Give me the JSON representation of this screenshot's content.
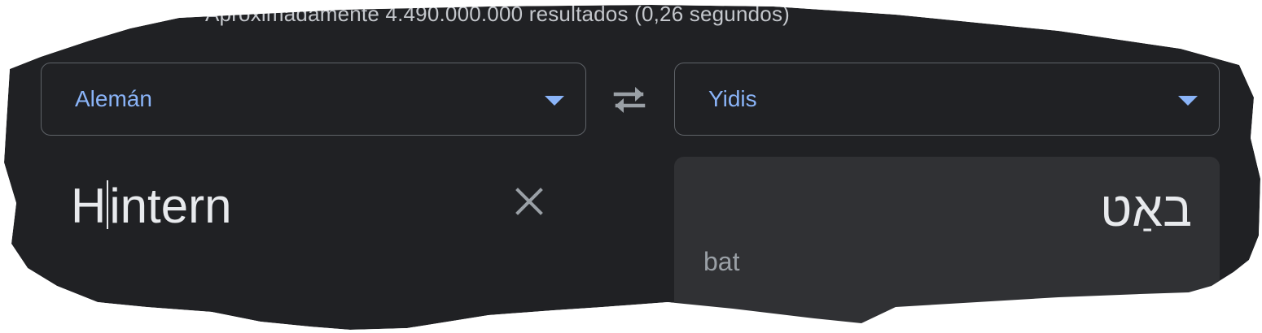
{
  "results": {
    "stats_text": "Aproximadamente 4.490.000.000 resultados (0,26 segundos)"
  },
  "translator": {
    "source_language": "Alemán",
    "target_language": "Yidis",
    "source_text_before_cursor": "H",
    "source_text_after_cursor": "intern",
    "translation": "באַט",
    "transliteration": "bat"
  },
  "icons": {
    "swap": "swap-languages-icon",
    "clear": "clear-text-icon",
    "dropdown": "dropdown-arrow-icon"
  },
  "colors": {
    "background": "#202124",
    "accent": "#8ab4f8",
    "text_primary": "#e8eaed",
    "text_secondary": "#9aa0a6",
    "panel": "#303134",
    "border": "#5f6368"
  }
}
